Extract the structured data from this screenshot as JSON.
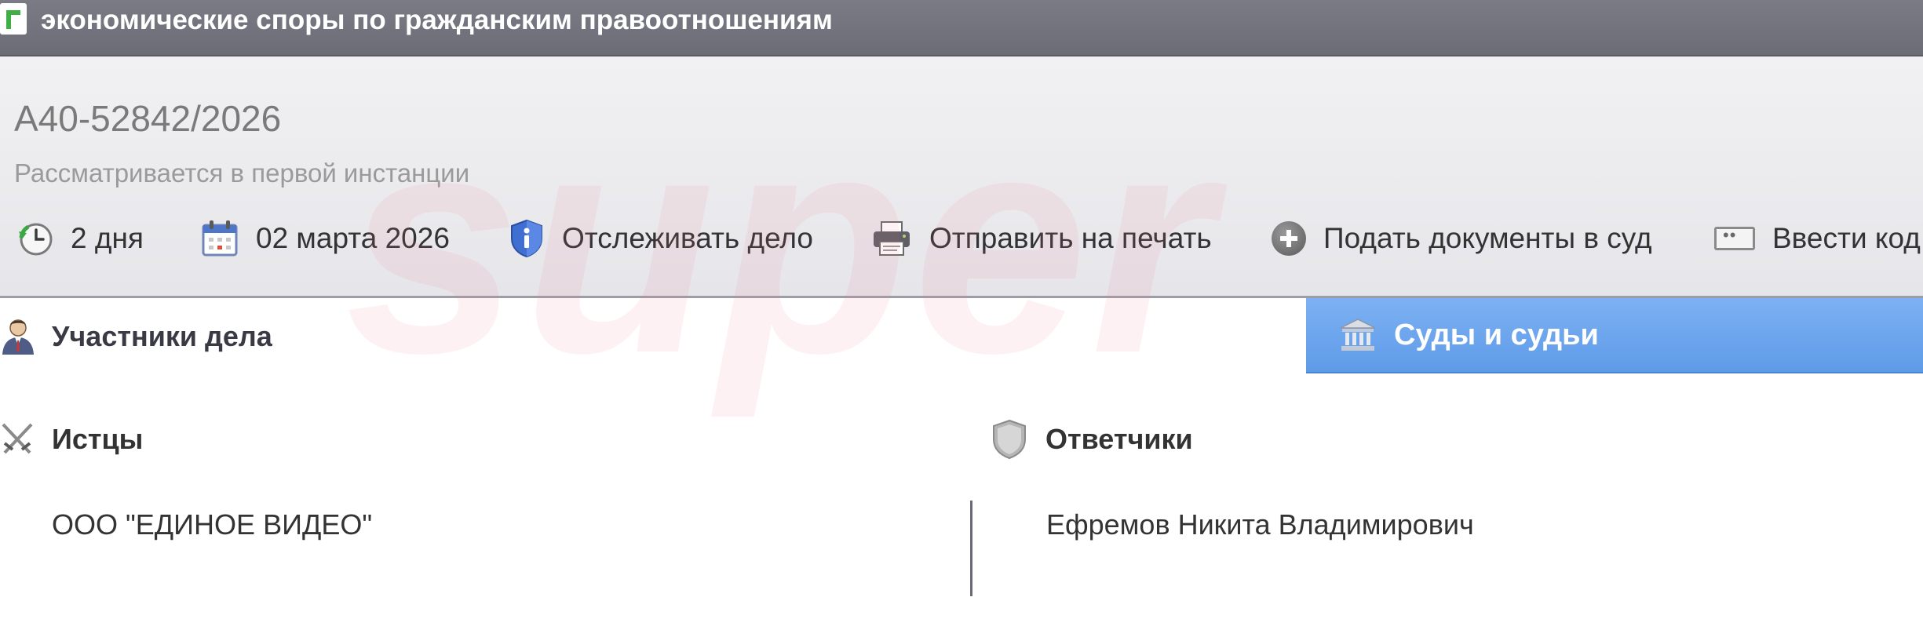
{
  "window": {
    "title": "экономические споры по гражданским правоотношениям"
  },
  "case": {
    "number": "А40-52842/2026",
    "status": "Рассматривается в первой инстанции"
  },
  "toolbar": {
    "duration": {
      "label": "2 дня",
      "icon": "clock-icon"
    },
    "date": {
      "label": "02 марта 2026",
      "icon": "calendar-icon"
    },
    "track": {
      "label": "Отслеживать дело",
      "icon": "shield-info-icon"
    },
    "print": {
      "label": "Отправить на печать",
      "icon": "printer-icon"
    },
    "submit": {
      "label": "Подать документы в суд",
      "icon": "plus-circle-icon"
    },
    "code": {
      "label": "Ввести код",
      "icon": "code-card-icon"
    }
  },
  "tabs": {
    "participants": {
      "label": "Участники дела",
      "icon": "person-icon"
    },
    "courts": {
      "label": "Суды и судьи",
      "icon": "bank-icon"
    }
  },
  "parties": {
    "plaintiffs": {
      "heading": "Истцы",
      "icon": "crossed-swords-icon",
      "items": [
        "ООО \"ЕДИНОЕ ВИДЕО\""
      ]
    },
    "defendants": {
      "heading": "Ответчики",
      "icon": "shield-icon",
      "items": [
        "Ефремов Никита Владимирович"
      ]
    }
  },
  "watermark": "super",
  "colors": {
    "titlebar": "#737380",
    "courts_tab": "#6ea7ee",
    "text": "#333333",
    "muted": "#9a9a9a"
  }
}
